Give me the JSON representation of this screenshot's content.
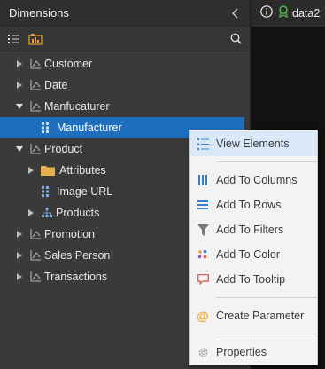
{
  "panel": {
    "title": "Dimensions"
  },
  "tabs": {
    "active_label": "data2"
  },
  "tree": [
    {
      "label": "Customer"
    },
    {
      "label": "Date"
    },
    {
      "label": "Manfucaturer"
    },
    {
      "label": "Manufacturer"
    },
    {
      "label": "Product"
    },
    {
      "label": "Attributes"
    },
    {
      "label": "Image URL"
    },
    {
      "label": "Products"
    },
    {
      "label": "Promotion"
    },
    {
      "label": "Sales Person"
    },
    {
      "label": "Transactions"
    }
  ],
  "menu": {
    "items": [
      {
        "label": "View Elements"
      },
      {
        "label": "Add To Columns"
      },
      {
        "label": "Add To Rows"
      },
      {
        "label": "Add To Filters"
      },
      {
        "label": "Add To Color"
      },
      {
        "label": "Add To Tooltip"
      },
      {
        "label": "Create Parameter"
      },
      {
        "label": "Properties"
      }
    ]
  },
  "colors": {
    "selection": "#1f6fbf",
    "menu_hover": "#d9e8f7",
    "folder": "#e8b04a",
    "accent_orange": "#f0a030",
    "menu_blue": "#3a7ec4"
  }
}
